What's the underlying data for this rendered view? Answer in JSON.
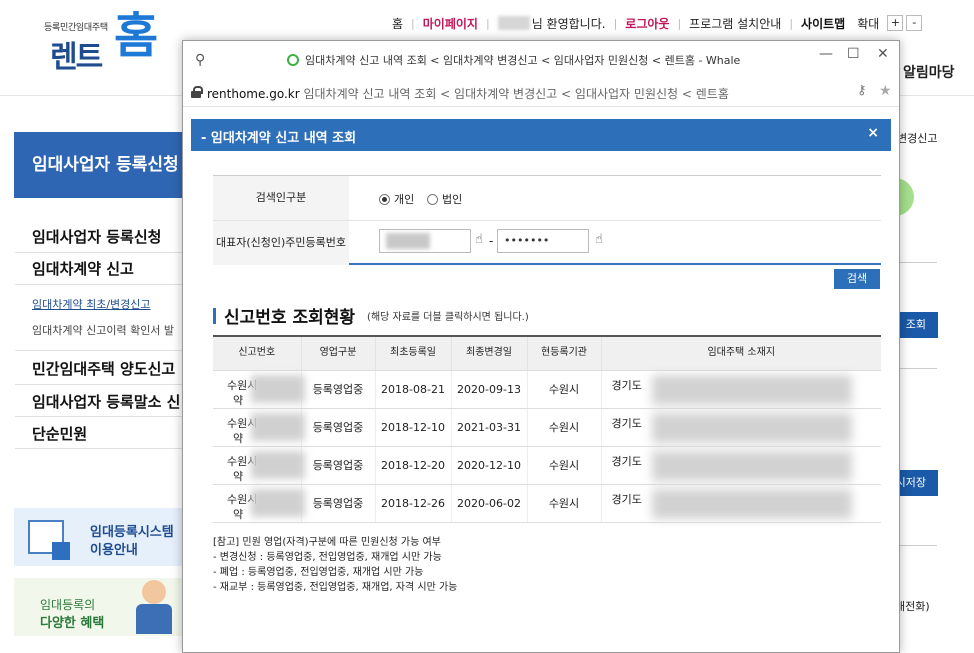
{
  "site": {
    "logo_sub": "등록민간임대주택",
    "logo_main": "렌트",
    "logo_home": "홈",
    "gnb": {
      "home": "홈",
      "mypage": "마이페이지",
      "welcome": "님 환영합니다.",
      "logout": "로그아웃",
      "install": "프로그램 설치안내",
      "sitemap": "사이트맵",
      "zoom": "확대",
      "zoom_in": "+",
      "zoom_out": "-"
    },
    "right_menu": "알림마당",
    "right_sub": "변경신고",
    "right_btn1": "조회",
    "right_btn2": "시저장",
    "right_text": "내전화)",
    "side_head": "임대사업자 등록신청",
    "side": {
      "item1": "임대사업자 등록신청",
      "item2": "임대차계약 신고",
      "sub1": "임대차계약 최초/변경신고",
      "sub2": "임대차계약 신고이력 확인서 발",
      "item3": "민간임대주택 양도신고",
      "item4": "임대사업자 등록말소 신",
      "item5": "단순민원"
    },
    "banner1": {
      "t1": "임대등록시스템",
      "t2": "이용안내"
    },
    "banner2": {
      "t1": "임대등록의",
      "t2": "다양한 혜택"
    }
  },
  "window": {
    "title": "임대차계약 신고 내역 조회 < 임대차계약 변경신고 < 임대사업자 민원신청 < 렌트홈 - Whale",
    "url_host": "renthome.go.kr",
    "url_rest": " 임대차계약 신고 내역 조회 < 임대차계약 변경신고 < 임대사업자 민원신청 < 렌트홈",
    "ctl_min": "—",
    "ctl_max": "☐",
    "ctl_close": "✕"
  },
  "popup": {
    "title": "- 임대차계약 신고 내역 조회",
    "close": "×",
    "form": {
      "searcher_label": "검색인구분",
      "radio_individual": "개인",
      "radio_corp": "법인",
      "rep_label_1": "대표자(신청인)",
      "rep_label_2": "주민등록번호",
      "dash": "-",
      "id_back_value": "•••••••",
      "search_button": "검색"
    },
    "section_title": "신고번호 조회현황",
    "section_hint": "(해당 자료를 더블 클릭하시면 됩니다.)",
    "table": {
      "headers": [
        "신고번호",
        "영업구분",
        "최초등록일",
        "최종변경일",
        "현등록기관",
        "임대주택 소재지"
      ],
      "rows": [
        {
          "no_1": "수원시",
          "no_2": "약",
          "type": "등록영업중",
          "first": "2018-08-21",
          "last": "2020-09-13",
          "agency": "수원시",
          "addr": "경기도"
        },
        {
          "no_1": "수원시",
          "no_2": "약",
          "type": "등록영업중",
          "first": "2018-12-10",
          "last": "2021-03-31",
          "agency": "수원시",
          "addr": "경기도"
        },
        {
          "no_1": "수원시",
          "no_2": "약",
          "type": "등록영업중",
          "first": "2018-12-20",
          "last": "2020-12-10",
          "agency": "수원시",
          "addr": "경기도"
        },
        {
          "no_1": "수원시",
          "no_2": "약",
          "type": "등록영업중",
          "first": "2018-12-26",
          "last": "2020-06-02",
          "agency": "수원시",
          "addr": "경기도"
        }
      ]
    },
    "notes": [
      "[참고] 민원 영업(자격)구분에 따른 민원신청 가능 여부",
      "- 변경신청 : 등록영업중, 전입영업중, 재개업 시만 가능",
      "- 폐업 : 등록영업중, 전입영업중, 재개업 시만 가능",
      "- 재교부 : 등록영업중, 전입영업중, 재개업, 자격 시만 가능"
    ]
  },
  "colors": {
    "brand_blue": "#2d6fb8",
    "logo_blue": "#1e78d6",
    "pink": "#c2185b"
  },
  "icons": [
    "pin-icon",
    "lock-icon",
    "key-icon",
    "star-icon",
    "finger-icon",
    "close-icon"
  ]
}
